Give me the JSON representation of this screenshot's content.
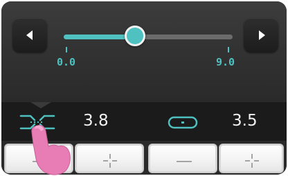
{
  "slider": {
    "min_label": "0.0",
    "max_label": "9.0",
    "min": 0.0,
    "max": 9.0,
    "value": 3.8
  },
  "settings": {
    "stitch_width_value": "3.8",
    "stitch_length_value": "3.5"
  },
  "icons": {
    "prev": "triangle-left-icon",
    "next": "triangle-right-icon",
    "stitch_width": "stitch-width-icon",
    "stitch_length": "stitch-length-icon",
    "minus": "minus-icon",
    "plus": "plus-icon",
    "finger": "finger-pointer-icon"
  },
  "colors": {
    "accent": "#4fc1c0",
    "panel_dark": "#1b1b1b",
    "finger_pink": "#e87cb5"
  }
}
